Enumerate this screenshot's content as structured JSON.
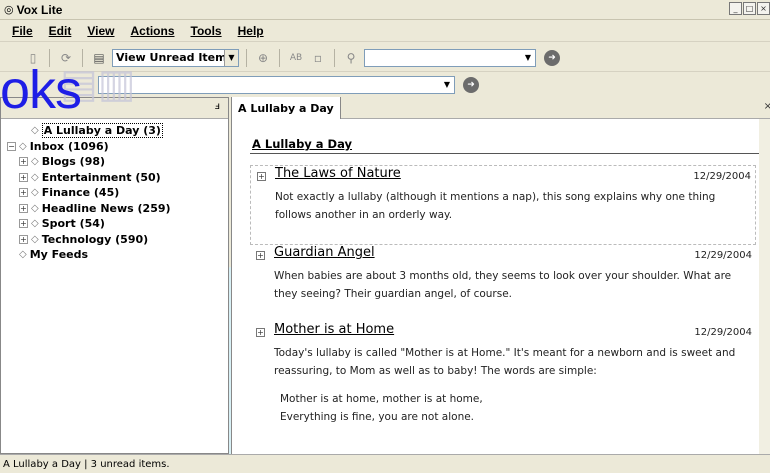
{
  "window": {
    "title": "Vox Lite"
  },
  "menu": [
    "File",
    "Edit",
    "View",
    "Actions",
    "Tools",
    "Help"
  ],
  "toolbar": {
    "view_select": "View Unread Items",
    "search_value": ""
  },
  "address": {
    "value": ""
  },
  "overlay": {
    "text": "oks"
  },
  "feeds": [
    {
      "label": "A Lullaby a Day (3)",
      "bold": true,
      "selected": true,
      "level": 0,
      "expander": ""
    },
    {
      "label": "Inbox (1096)",
      "bold": true,
      "level": 0,
      "expander": "-"
    },
    {
      "label": "Blogs (98)",
      "bold": true,
      "level": 1,
      "expander": "+"
    },
    {
      "label": "Entertainment (50)",
      "bold": true,
      "level": 1,
      "expander": "+"
    },
    {
      "label": "Finance (45)",
      "bold": true,
      "level": 1,
      "expander": "+"
    },
    {
      "label": "Headline News (259)",
      "bold": true,
      "level": 1,
      "expander": "+"
    },
    {
      "label": "Sport (54)",
      "bold": true,
      "level": 1,
      "expander": "+"
    },
    {
      "label": "Technology (590)",
      "bold": true,
      "level": 1,
      "expander": "+"
    },
    {
      "label": "My Feeds",
      "bold": true,
      "level": 0,
      "expander": ""
    }
  ],
  "tab": {
    "label": "A Lullaby a Day"
  },
  "feed_title": "A Lullaby a Day",
  "articles": [
    {
      "title": "The Laws of Nature",
      "date": "12/29/2004",
      "body": "Not exactly a lullaby (although it mentions a nap), this song explains why one thing follows another in an orderly way."
    },
    {
      "title": "Guardian Angel",
      "date": "12/29/2004",
      "body": "When babies are about 3 months old, they seems to look over your shoulder. What are they seeing? Their guardian angel, of course."
    },
    {
      "title": "Mother is at Home",
      "date": "12/29/2004",
      "body": "Today's lullaby is called \"Mother is at Home.\" It's meant for a newborn and is sweet and reassuring, to Mom as well as to baby! The words are simple:",
      "quote_line1": "Mother is at home, mother is at home,",
      "quote_line2": "Everything is fine, you are not alone."
    }
  ],
  "status": "A Lullaby a Day | 3 unread items.",
  "colors": {
    "overlay_blue": "#1e1ee6",
    "background_wave": "#d8f0f5"
  }
}
